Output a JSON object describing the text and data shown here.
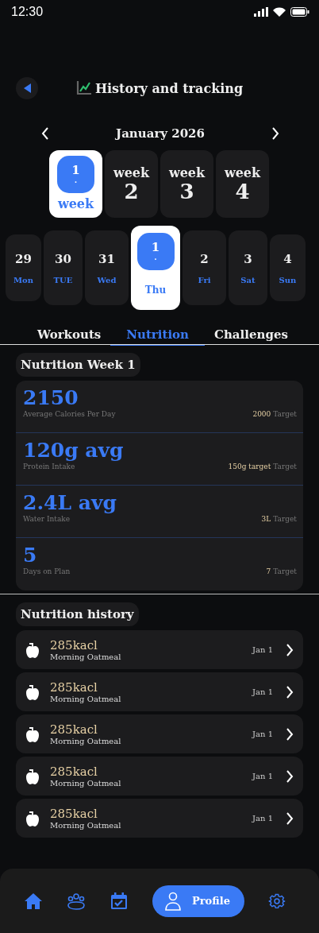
{
  "status_bar": {
    "time": "12:30"
  },
  "header": {
    "title": "History and tracking"
  },
  "month": {
    "label": "January 2026"
  },
  "weeks": [
    {
      "word": "week",
      "number": "1",
      "mark": ".",
      "selected": true
    },
    {
      "word": "week",
      "number": "2",
      "selected": false
    },
    {
      "word": "week",
      "number": "3",
      "selected": false
    },
    {
      "word": "week",
      "number": "4",
      "selected": false
    }
  ],
  "days": [
    {
      "date": "29",
      "day": "Mon",
      "selected": false
    },
    {
      "date": "30",
      "day": "TUE",
      "selected": false
    },
    {
      "date": "31",
      "day": "Wed",
      "selected": false
    },
    {
      "date": "1",
      "day": "Thu",
      "mark": ".",
      "selected": true
    },
    {
      "date": "2",
      "day": "Fri",
      "selected": false
    },
    {
      "date": "3",
      "day": "Sat",
      "selected": false
    },
    {
      "date": "4",
      "day": "Sun",
      "selected": false
    }
  ],
  "tabs": [
    {
      "label": "Workouts",
      "selected": false
    },
    {
      "label": "Nutrition",
      "selected": true
    },
    {
      "label": "Challenges",
      "selected": false
    }
  ],
  "summary": {
    "title": "Nutrition Week 1",
    "stats": [
      {
        "value": "2150",
        "label": "Average Calories Per Day",
        "target_value": "2000",
        "target_label": "Target"
      },
      {
        "value": "120g avg",
        "label": "Protein Intake",
        "target_value": "150g target",
        "target_label": "Target"
      },
      {
        "value": "2.4L avg",
        "label": "Water Intake",
        "target_value": "3L",
        "target_label": "Target"
      },
      {
        "value": "5",
        "label": "Days on Plan",
        "target_value": "7",
        "target_label": "Target"
      }
    ]
  },
  "history": {
    "title": "Nutrition history",
    "items": [
      {
        "calories": "285kacl",
        "meal": "Morning Oatmeal",
        "date": "Jan 1"
      },
      {
        "calories": "285kacl",
        "meal": "Morning Oatmeal",
        "date": "Jan 1"
      },
      {
        "calories": "285kacl",
        "meal": "Morning Oatmeal",
        "date": "Jan 1"
      },
      {
        "calories": "285kacl",
        "meal": "Morning Oatmeal",
        "date": "Jan 1"
      },
      {
        "calories": "285kacl",
        "meal": "Morning Oatmeal",
        "date": "Jan 1"
      }
    ]
  },
  "nav": [
    {
      "kind": "home",
      "selected": false
    },
    {
      "kind": "group",
      "selected": false
    },
    {
      "kind": "calendar",
      "selected": false
    },
    {
      "kind": "profile",
      "label": "Profile",
      "selected": true
    },
    {
      "kind": "settings",
      "selected": false
    }
  ]
}
